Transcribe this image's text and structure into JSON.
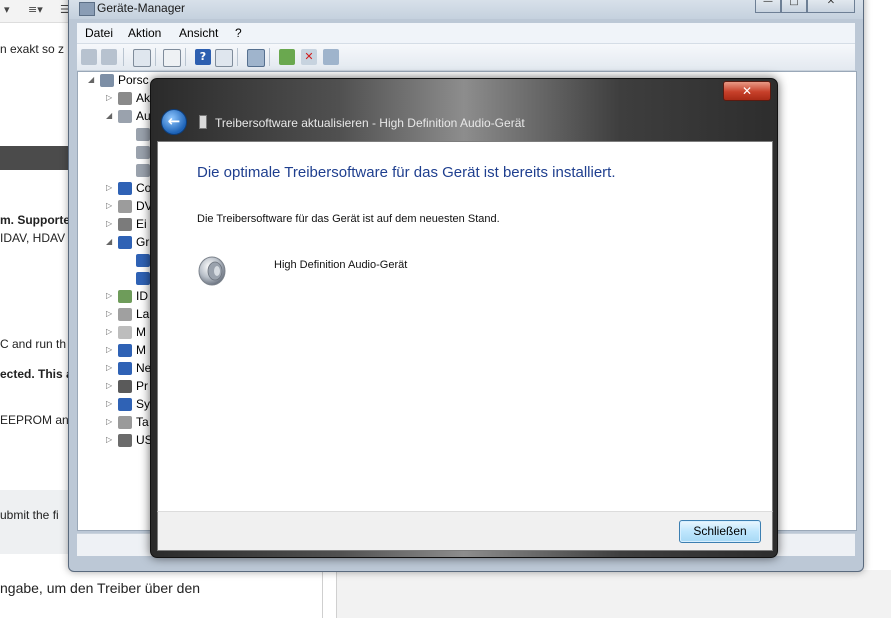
{
  "background_page": {
    "toolbar_glyphs": [
      "▾",
      "≡▾",
      "☰"
    ],
    "lines": [
      "n exakt so z",
      "m. Supporte",
      "IDAV, HDAV",
      "C and run th",
      "ected. This a",
      "EEPROM an",
      "ubmit the fi",
      "ngabe, um den Treiber über den"
    ]
  },
  "device_manager": {
    "title": "Geräte-Manager",
    "window_buttons": {
      "minimize": "—",
      "maximize": "□",
      "close": "✕"
    },
    "menu": [
      "Datei",
      "Aktion",
      "Ansicht",
      "?"
    ],
    "toolbar_icons": [
      "back-icon",
      "forward-icon",
      "show-hide-tree-icon",
      "properties-icon",
      "help-icon",
      "action-pane-icon",
      "scan-hardware-icon",
      "update-driver-icon",
      "disable-device-icon",
      "uninstall-icon"
    ],
    "tree": [
      {
        "arrow": "◢",
        "label": "Porsc",
        "icon": "computer-icon"
      },
      {
        "arrow": "▷",
        "label": "Ak",
        "icon": "battery-icon"
      },
      {
        "arrow": "◢",
        "label": "Au",
        "icon": "speaker-icon"
      },
      {
        "arrow": "",
        "label": "",
        "icon": "speaker-small-icon"
      },
      {
        "arrow": "",
        "label": "",
        "icon": "speaker-small-icon"
      },
      {
        "arrow": "",
        "label": "",
        "icon": "speaker-small-icon"
      },
      {
        "arrow": "▷",
        "label": "Co",
        "icon": "monitor-icon"
      },
      {
        "arrow": "▷",
        "label": "DV",
        "icon": "dvd-drive-icon"
      },
      {
        "arrow": "▷",
        "label": "Ei",
        "icon": "input-device-icon"
      },
      {
        "arrow": "◢",
        "label": "Gr",
        "icon": "display-adapter-icon"
      },
      {
        "arrow": "",
        "label": "",
        "icon": "display-adapter-icon"
      },
      {
        "arrow": "",
        "label": "",
        "icon": "display-adapter-icon"
      },
      {
        "arrow": "▷",
        "label": "ID",
        "icon": "ide-controller-icon"
      },
      {
        "arrow": "▷",
        "label": "La",
        "icon": "drive-icon"
      },
      {
        "arrow": "▷",
        "label": "M",
        "icon": "mouse-icon"
      },
      {
        "arrow": "▷",
        "label": "M",
        "icon": "monitor-icon"
      },
      {
        "arrow": "▷",
        "label": "Ne",
        "icon": "network-icon"
      },
      {
        "arrow": "▷",
        "label": "Pr",
        "icon": "processor-icon"
      },
      {
        "arrow": "▷",
        "label": "Sy",
        "icon": "system-device-icon"
      },
      {
        "arrow": "▷",
        "label": "Ta",
        "icon": "keyboard-icon"
      },
      {
        "arrow": "▷",
        "label": "US",
        "icon": "usb-icon"
      }
    ]
  },
  "dialog": {
    "close_glyph": "✕",
    "back_glyph": "←",
    "title": "Treibersoftware aktualisieren - High Definition Audio-Gerät",
    "heading": "Die optimale Treibersoftware für das Gerät ist bereits installiert.",
    "message": "Die Treibersoftware für das Gerät ist auf dem neuesten Stand.",
    "device_name": "High Definition Audio-Gerät",
    "device_icon": "speaker-icon",
    "close_button": "Schließen"
  },
  "colors": {
    "heading_blue": "#1f3f8f",
    "close_red": "#c7402a",
    "button_blue": "#bee6fd"
  }
}
